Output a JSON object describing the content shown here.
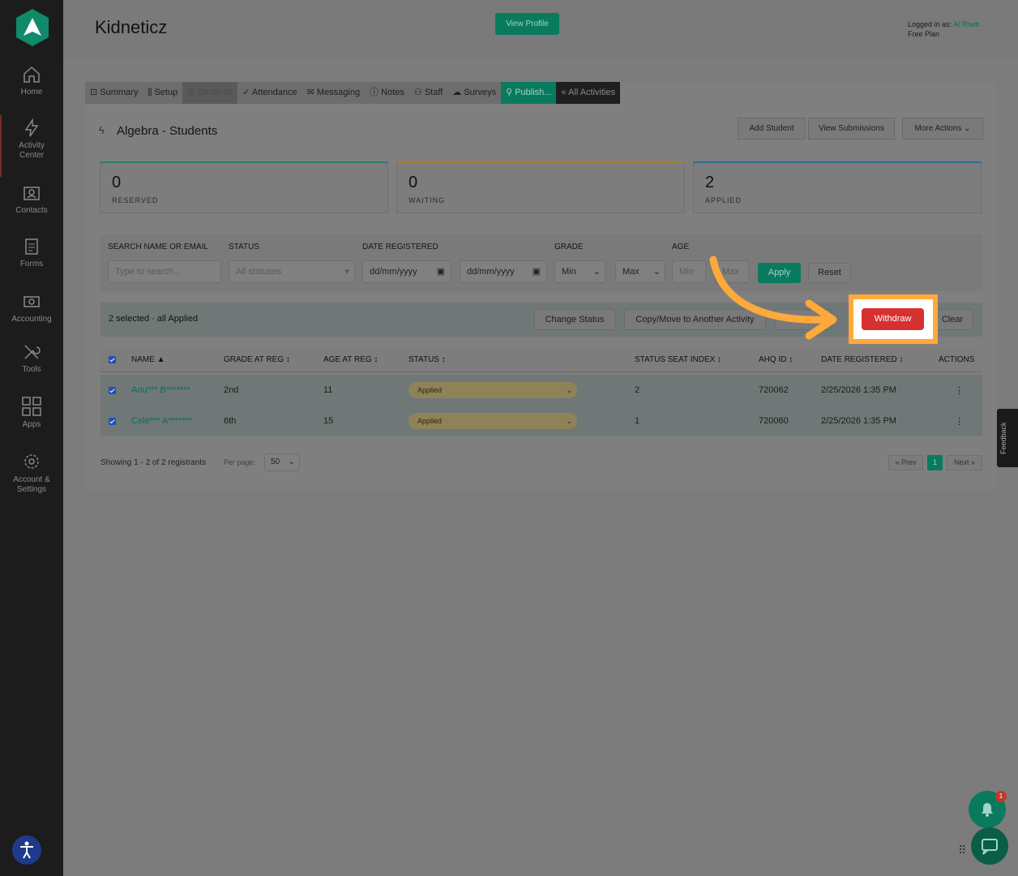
{
  "sidebar": {
    "items": [
      {
        "label": "Home",
        "icon": "home-icon"
      },
      {
        "label": "Activity Center",
        "icon": "bolt-icon"
      },
      {
        "label": "Contacts",
        "icon": "contacts-icon"
      },
      {
        "label": "Forms",
        "icon": "forms-icon"
      },
      {
        "label": "Accounting",
        "icon": "accounting-icon"
      },
      {
        "label": "Tools",
        "icon": "tools-icon"
      },
      {
        "label": "Apps",
        "icon": "apps-icon"
      },
      {
        "label": "Account & Settings",
        "icon": "settings-icon"
      }
    ]
  },
  "header": {
    "title": "Kidneticz",
    "view_profile": "View Profile",
    "logged_in_prefix": "Logged in as:",
    "user": "Al Rhett",
    "plan": "Free Plan"
  },
  "tabs": [
    "Summary",
    "Setup",
    "Students",
    "Attendance",
    "Messaging",
    "Notes",
    "Staff",
    "Surveys",
    "Publish...",
    "« All Activities"
  ],
  "section": {
    "title": "Algebra - Students",
    "add_student": "Add Student",
    "view_submissions": "View Submissions",
    "more_actions": "More Actions"
  },
  "stats": [
    {
      "value": "0",
      "label": "RESERVED",
      "color": "#2a7d6a"
    },
    {
      "value": "0",
      "label": "WAITING",
      "color": "#a37a34"
    },
    {
      "value": "2",
      "label": "APPLIED",
      "color": "#2a6f8a"
    }
  ],
  "filters": {
    "search_label": "SEARCH NAME OR EMAIL",
    "search_placeholder": "Type to search...",
    "status_label": "STATUS",
    "status_value": "All statuses",
    "date_label": "DATE REGISTERED",
    "date_from": "dd/mm/yyyy",
    "date_to": "dd/mm/yyyy",
    "grade_label": "GRADE",
    "grade_min": "Min",
    "grade_max": "Max",
    "age_label": "AGE",
    "age_min": "Min",
    "age_max": "Max",
    "apply": "Apply",
    "reset": "Reset"
  },
  "bulk": {
    "selected_text": "2 selected · all Applied",
    "change_status": "Change Status",
    "copy_move": "Copy/Move to Another Activity",
    "link_partial": "nk",
    "withdraw": "Withdraw",
    "clear": "Clear"
  },
  "table": {
    "headers": [
      "NAME ▲",
      "GRADE AT REG ↕",
      "AGE AT REG ↕",
      "STATUS ↕",
      "STATUS SEAT INDEX ↕",
      "AHQ ID ↕",
      "DATE REGISTERED ↕",
      "ACTIONS"
    ],
    "rows": [
      {
        "name": "Anu*** B*******",
        "grade": "2nd",
        "age": "11",
        "status": "Applied",
        "seat": "2",
        "ahq": "720062",
        "date": "2/25/2026 1:35 PM",
        "actions": "⋮"
      },
      {
        "name": "Cele*** A*******",
        "grade": "6th",
        "age": "15",
        "status": "Applied",
        "seat": "1",
        "ahq": "720060",
        "date": "2/25/2026 1:35 PM",
        "actions": "⋮"
      }
    ]
  },
  "footer": {
    "showing": "Showing 1 - 2 of 2 registrants",
    "per_page_label": "Per page:",
    "per_page_value": "50",
    "prev": "« Prev",
    "page": "1",
    "next": "Next »"
  },
  "widgets": {
    "feedback": "Feedback",
    "notif_count": "1"
  }
}
